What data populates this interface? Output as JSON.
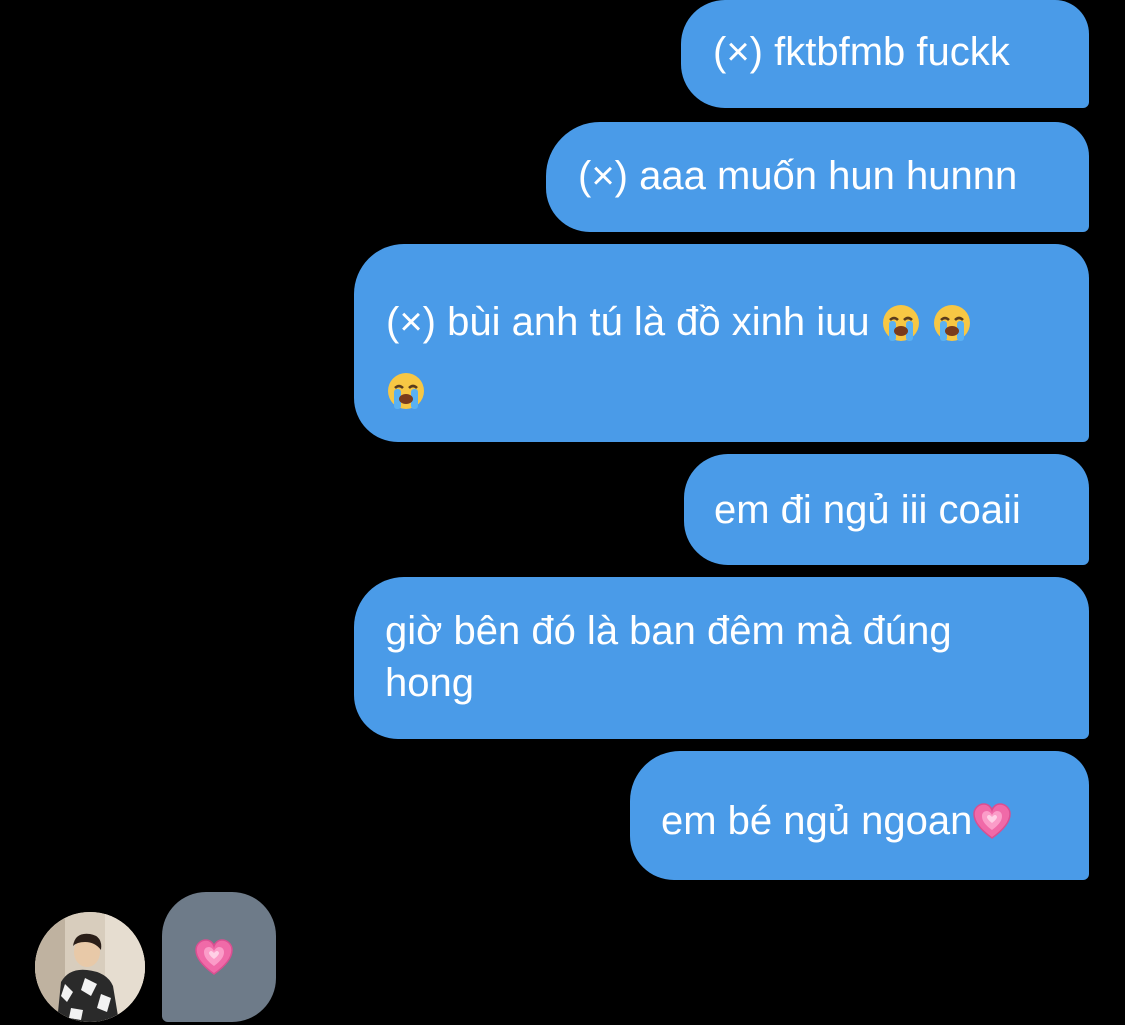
{
  "messages": {
    "sent": [
      {
        "text": "(×) fktbfmb fuckk"
      },
      {
        "text": "(×) aaa muốn hun hunnn"
      },
      {
        "text": "(×) bùi anh tú là đồ xinh iuu",
        "trailing_emoji": [
          "loudly-crying-face",
          "loudly-crying-face",
          "loudly-crying-face"
        ]
      },
      {
        "text": "em đi ngủ iii coaii"
      },
      {
        "text": "giờ bên đó là ban đêm mà đúng hong"
      },
      {
        "text": "em bé ngủ ngoan",
        "trailing_emoji": [
          "growing-heart"
        ]
      }
    ],
    "received": [
      {
        "emoji": "growing-heart"
      }
    ]
  },
  "colors": {
    "background": "#000000",
    "sent_bubble": "#4a9be8",
    "received_bubble": "#6e7b89",
    "text": "#ffffff",
    "heart": "#f06aa8"
  },
  "avatar": {
    "icon": "user-avatar-photo"
  }
}
